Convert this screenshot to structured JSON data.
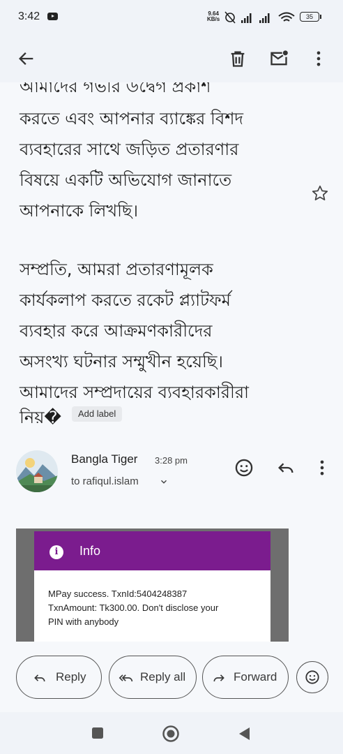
{
  "status_bar": {
    "time": "3:42",
    "net_speed_value": "9.64",
    "net_speed_unit": "KB/s",
    "battery": "35"
  },
  "toolbar": {
    "back": "arrow-back-icon",
    "delete": "trash-icon",
    "mark_unread": "mail-unread-icon",
    "more": "more-vert-icon"
  },
  "email_body": {
    "lines_1": [
      "আমাদের গভীর উদ্বেগ প্রকাশ",
      "করতে এবং আপনার ব্যাঙ্কের বিশদ",
      "ব্যবহারের সাথে জড়িত প্রতারণার",
      "বিষয়ে একটি অভিযোগ জানাতে",
      "আপনাকে লিখছি।"
    ],
    "lines_2": [
      "সম্প্রতি, আমরা প্রতারণামূলক",
      "কার্যকলাপ করতে রকেট প্ল্যাটফর্ম",
      "ব্যবহার করে আক্রমণকারীদের",
      "অসংখ্য ঘটনার সম্মুখীন হয়েছি।",
      "আমাদের সম্প্রদায়ের ব্যবহারকারীরা"
    ],
    "last_line": "নিয়�",
    "add_label": "Add label"
  },
  "message_header": {
    "sender": "Bangla Tiger",
    "time": "3:28 pm",
    "to": "to rafiqul.islam"
  },
  "attachment": {
    "title": "Info",
    "message_lines": [
      "MPay success. TxnId:5404248387",
      "TxnAmount: Tk300.00. Don't disclose your",
      "PIN with anybody"
    ]
  },
  "actions": {
    "reply": "Reply",
    "reply_all": "Reply all",
    "forward": "Forward"
  },
  "colors": {
    "accent": "#7b1c8e",
    "background": "#f6f8fb"
  }
}
